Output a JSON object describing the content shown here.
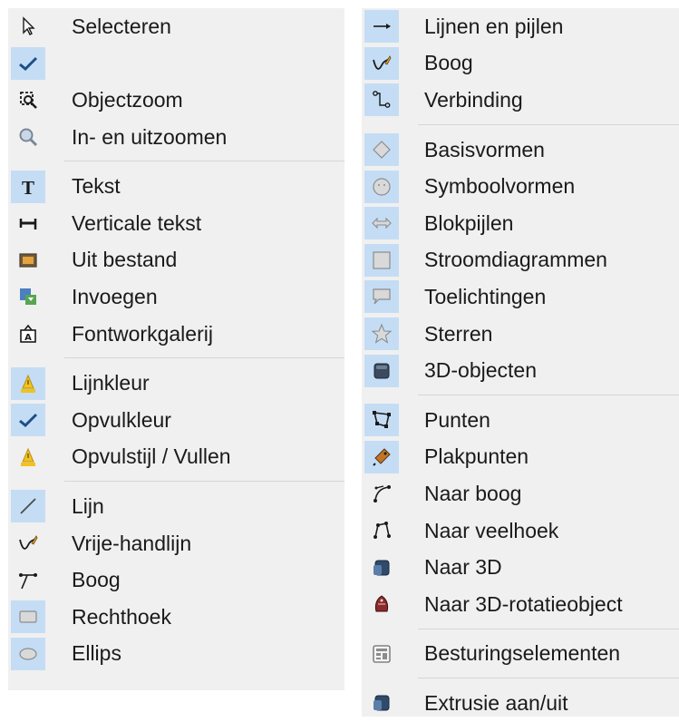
{
  "left_menu": {
    "items": [
      {
        "label": "Selecteren",
        "icon": "select-arrow-icon",
        "checked": false,
        "highlight": false
      },
      {
        "label": "",
        "icon": "checkmark-icon",
        "checked": true,
        "highlight": true
      },
      {
        "label": "Objectzoom",
        "icon": "object-zoom-icon",
        "checked": false,
        "highlight": false
      },
      {
        "label": "In- en uitzoomen",
        "icon": "zoom-magnifier-icon",
        "checked": false,
        "highlight": false
      },
      {
        "label": "Tekst",
        "icon": "text-t-icon",
        "checked": false,
        "highlight": true
      },
      {
        "label": "Verticale tekst",
        "icon": "vertical-text-icon",
        "checked": false,
        "highlight": false
      },
      {
        "label": "Uit bestand",
        "icon": "image-from-file-icon",
        "checked": false,
        "highlight": false
      },
      {
        "label": "Invoegen",
        "icon": "insert-object-icon",
        "checked": false,
        "highlight": false
      },
      {
        "label": "Fontworkgalerij",
        "icon": "fontwork-gallery-icon",
        "checked": false,
        "highlight": false
      },
      {
        "label": "Lijnkleur",
        "icon": "line-color-icon",
        "checked": false,
        "highlight": true
      },
      {
        "label": "Opvulkleur",
        "icon": "checkmark-icon",
        "checked": true,
        "highlight": true
      },
      {
        "label": "Opvulstijl / Vullen",
        "icon": "fill-style-icon",
        "checked": false,
        "highlight": false
      },
      {
        "label": "Lijn",
        "icon": "line-icon",
        "checked": false,
        "highlight": true
      },
      {
        "label": "Vrije-handlijn",
        "icon": "freeform-line-icon",
        "checked": false,
        "highlight": false
      },
      {
        "label": "Boog",
        "icon": "curve-icon",
        "checked": false,
        "highlight": false
      },
      {
        "label": "Rechthoek",
        "icon": "rectangle-icon",
        "checked": false,
        "highlight": true
      },
      {
        "label": "Ellips",
        "icon": "ellipse-icon",
        "checked": false,
        "highlight": true
      }
    ]
  },
  "right_menu": {
    "items": [
      {
        "label": "Lijnen en pijlen",
        "icon": "line-arrow-icon",
        "highlight": true
      },
      {
        "label": "Boog",
        "icon": "curve-pen-icon",
        "highlight": true
      },
      {
        "label": "Verbinding",
        "icon": "connector-icon",
        "highlight": true
      },
      {
        "label": "Basisvormen",
        "icon": "diamond-shape-icon",
        "highlight": true
      },
      {
        "label": "Symboolvormen",
        "icon": "smiley-shape-icon",
        "highlight": true
      },
      {
        "label": "Blokpijlen",
        "icon": "block-arrow-icon",
        "highlight": true
      },
      {
        "label": "Stroomdiagrammen",
        "icon": "flowchart-icon",
        "highlight": true
      },
      {
        "label": "Toelichtingen",
        "icon": "callout-icon",
        "highlight": true
      },
      {
        "label": "Sterren",
        "icon": "star-icon",
        "highlight": true
      },
      {
        "label": "3D-objecten",
        "icon": "cube-icon",
        "highlight": true
      },
      {
        "label": "Punten",
        "icon": "points-icon",
        "highlight": true
      },
      {
        "label": "Plakpunten",
        "icon": "glue-points-icon",
        "highlight": true
      },
      {
        "label": "Naar boog",
        "icon": "to-curve-icon",
        "highlight": false
      },
      {
        "label": "Naar veelhoek",
        "icon": "to-polygon-icon",
        "highlight": false
      },
      {
        "label": "Naar 3D",
        "icon": "to-3d-icon",
        "highlight": false
      },
      {
        "label": "Naar 3D-rotatieobject",
        "icon": "to-3d-rotation-icon",
        "highlight": false
      },
      {
        "label": "Besturingselementen",
        "icon": "form-controls-icon",
        "highlight": false
      },
      {
        "label": "Extrusie aan/uit",
        "icon": "extrusion-icon",
        "highlight": false
      }
    ]
  },
  "colors": {
    "menu_bg": "#f0f0f0",
    "icon_highlight": "#c4ddf5",
    "checkmark": "#1e4f86",
    "separator": "#d6d6d6"
  }
}
